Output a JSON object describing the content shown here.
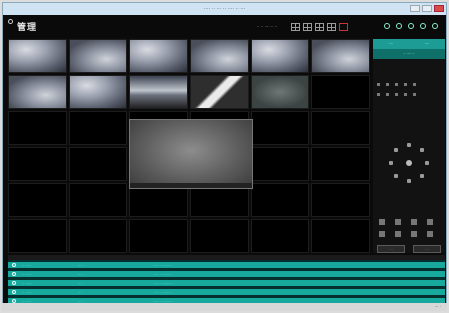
{
  "window": {
    "title": "···· ·· ··· ·· ···· ·· ···"
  },
  "toolbar": {
    "logo": "管理",
    "time": "·· ·· ···· ·· ··"
  },
  "cells": [
    {
      "label": "",
      "kind": "cam"
    },
    {
      "label": "",
      "kind": "cam2"
    },
    {
      "label": "",
      "kind": "cam"
    },
    {
      "label": "",
      "kind": "cam2"
    },
    {
      "label": "",
      "kind": "cam"
    },
    {
      "label": "",
      "kind": "cam2"
    },
    {
      "label": "",
      "kind": "cam2"
    },
    {
      "label": "",
      "kind": "cam"
    },
    {
      "label": "",
      "kind": "cam3"
    },
    {
      "label": "",
      "kind": "cam4"
    },
    {
      "label": "",
      "kind": "cam5"
    },
    {
      "label": "",
      "kind": "empty"
    },
    {
      "label": "",
      "kind": "empty"
    },
    {
      "label": "",
      "kind": "empty"
    },
    {
      "label": "",
      "kind": "empty"
    },
    {
      "label": "",
      "kind": "empty"
    },
    {
      "label": "",
      "kind": "empty"
    },
    {
      "label": "",
      "kind": "empty"
    },
    {
      "label": "",
      "kind": "empty"
    },
    {
      "label": "",
      "kind": "empty"
    },
    {
      "label": "",
      "kind": "empty"
    },
    {
      "label": "",
      "kind": "empty"
    },
    {
      "label": "",
      "kind": "empty"
    },
    {
      "label": "",
      "kind": "empty"
    },
    {
      "label": "",
      "kind": "empty"
    },
    {
      "label": "",
      "kind": "empty"
    },
    {
      "label": "",
      "kind": "empty"
    },
    {
      "label": "",
      "kind": "empty"
    },
    {
      "label": "",
      "kind": "empty"
    },
    {
      "label": "",
      "kind": "empty"
    },
    {
      "label": "",
      "kind": "empty"
    },
    {
      "label": "",
      "kind": "empty"
    },
    {
      "label": "",
      "kind": "empty"
    },
    {
      "label": "",
      "kind": "empty"
    },
    {
      "label": "",
      "kind": "empty"
    },
    {
      "label": "",
      "kind": "empty"
    }
  ],
  "panel": {
    "tabs": [
      "····",
      "····"
    ],
    "sub": "·· ···· ··",
    "presets": [
      "·····",
      "·····",
      "·····",
      "·····",
      "·····",
      "·····"
    ]
  },
  "events": [
    {
      "c1": "·· ·······",
      "c2": "·· ··",
      "c3": "···· ·· ·· ········"
    },
    {
      "c1": "·· ·······",
      "c2": "·· ··",
      "c3": "···· ·· ·· ········"
    },
    {
      "c1": "·· ·······",
      "c2": "·· ··",
      "c3": "···· ·· ·· ········"
    },
    {
      "c1": "·· ·······",
      "c2": "·· ··",
      "c3": "···· ·· ·· ········"
    },
    {
      "c1": "·· ·······",
      "c2": "·· ··",
      "c3": "···· ·· ·· ········"
    }
  ],
  "footer": {
    "corner": "··· ·"
  },
  "colors": {
    "accent": "#17a99e",
    "panelTab": "#1c9c94",
    "background": "#0b0b0b"
  }
}
